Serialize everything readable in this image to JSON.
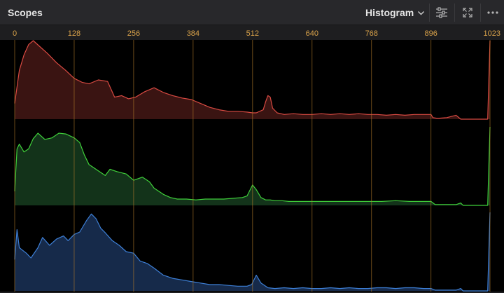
{
  "panel": {
    "title": "Scopes",
    "mode_label": "Histogram",
    "icons": [
      "chevron-down-icon",
      "sliders-icon",
      "expand-icon",
      "more-icon"
    ]
  },
  "colors": {
    "header_bg": "#28282b",
    "plot_bg": "#000000",
    "guide": "#b07a2a",
    "tick_text": "#d9a24a",
    "red_line": "#d94a42",
    "red_fill": "#3a1412",
    "green_line": "#3fcf3a",
    "green_fill": "#13331a",
    "blue_line": "#3d7fd6",
    "blue_fill": "#162a4a"
  },
  "chart_data": {
    "type": "area",
    "x_ticks": [
      "0",
      "128",
      "256",
      "384",
      "512",
      "640",
      "768",
      "896",
      "1023"
    ],
    "xlim": [
      0,
      1023
    ],
    "ylim": [
      0,
      1
    ],
    "grid": true,
    "series": [
      {
        "channel": "red",
        "x": [
          0,
          10,
          20,
          30,
          40,
          55,
          70,
          90,
          110,
          128,
          145,
          160,
          180,
          200,
          215,
          230,
          245,
          260,
          280,
          300,
          320,
          340,
          360,
          380,
          400,
          420,
          440,
          460,
          480,
          500,
          512,
          520,
          535,
          540,
          545,
          550,
          555,
          565,
          580,
          600,
          620,
          640,
          660,
          680,
          700,
          720,
          740,
          760,
          780,
          800,
          820,
          840,
          860,
          880,
          896,
          900,
          910,
          930,
          950,
          960,
          965,
          970,
          990,
          1010,
          1018,
          1023
        ],
        "y": [
          0.2,
          0.62,
          0.82,
          0.95,
          1.0,
          0.92,
          0.84,
          0.72,
          0.62,
          0.52,
          0.47,
          0.45,
          0.5,
          0.48,
          0.28,
          0.3,
          0.26,
          0.28,
          0.35,
          0.4,
          0.34,
          0.3,
          0.27,
          0.25,
          0.2,
          0.15,
          0.12,
          0.1,
          0.1,
          0.09,
          0.08,
          0.08,
          0.12,
          0.22,
          0.3,
          0.28,
          0.14,
          0.08,
          0.06,
          0.07,
          0.06,
          0.06,
          0.07,
          0.06,
          0.07,
          0.06,
          0.07,
          0.06,
          0.06,
          0.05,
          0.06,
          0.05,
          0.06,
          0.06,
          0.06,
          0.02,
          0.01,
          0.02,
          0.05,
          0.0,
          0.0,
          0.0,
          0.0,
          0.0,
          0.0,
          1.0
        ]
      },
      {
        "channel": "green",
        "x": [
          0,
          5,
          10,
          20,
          30,
          40,
          50,
          65,
          80,
          95,
          110,
          128,
          140,
          150,
          160,
          180,
          195,
          205,
          220,
          240,
          256,
          275,
          290,
          300,
          320,
          335,
          350,
          370,
          390,
          410,
          430,
          450,
          470,
          490,
          500,
          512,
          520,
          530,
          540,
          550,
          560,
          575,
          590,
          610,
          640,
          670,
          700,
          730,
          760,
          790,
          820,
          850,
          880,
          896,
          905,
          920,
          950,
          960,
          965,
          975,
          990,
          1010,
          1018,
          1023
        ],
        "y": [
          0.18,
          0.72,
          0.78,
          0.68,
          0.72,
          0.85,
          0.92,
          0.84,
          0.86,
          0.92,
          0.91,
          0.86,
          0.8,
          0.64,
          0.52,
          0.44,
          0.38,
          0.46,
          0.43,
          0.4,
          0.32,
          0.36,
          0.3,
          0.22,
          0.14,
          0.1,
          0.08,
          0.08,
          0.07,
          0.08,
          0.08,
          0.08,
          0.09,
          0.1,
          0.12,
          0.26,
          0.2,
          0.1,
          0.07,
          0.07,
          0.06,
          0.06,
          0.05,
          0.05,
          0.05,
          0.05,
          0.05,
          0.05,
          0.05,
          0.05,
          0.06,
          0.05,
          0.05,
          0.05,
          0.01,
          0.01,
          0.01,
          0.03,
          0.0,
          0.0,
          0.0,
          0.0,
          0.0,
          1.0
        ]
      },
      {
        "channel": "blue",
        "x": [
          0,
          5,
          10,
          25,
          35,
          50,
          60,
          75,
          90,
          105,
          115,
          128,
          140,
          155,
          165,
          175,
          185,
          195,
          210,
          225,
          240,
          256,
          270,
          285,
          300,
          320,
          340,
          360,
          380,
          400,
          420,
          440,
          460,
          480,
          500,
          510,
          520,
          530,
          545,
          560,
          580,
          600,
          620,
          640,
          660,
          680,
          700,
          720,
          740,
          760,
          780,
          800,
          820,
          840,
          860,
          880,
          896,
          905,
          920,
          950,
          960,
          965,
          975,
          990,
          1010,
          1018,
          1023
        ],
        "y": [
          0.4,
          0.78,
          0.55,
          0.48,
          0.42,
          0.55,
          0.68,
          0.58,
          0.66,
          0.7,
          0.64,
          0.72,
          0.75,
          0.9,
          0.98,
          0.92,
          0.8,
          0.74,
          0.64,
          0.58,
          0.5,
          0.48,
          0.38,
          0.35,
          0.29,
          0.2,
          0.16,
          0.14,
          0.12,
          0.1,
          0.08,
          0.08,
          0.07,
          0.06,
          0.06,
          0.08,
          0.2,
          0.1,
          0.04,
          0.03,
          0.04,
          0.03,
          0.04,
          0.03,
          0.03,
          0.04,
          0.03,
          0.04,
          0.03,
          0.03,
          0.04,
          0.04,
          0.03,
          0.04,
          0.04,
          0.03,
          0.03,
          0.01,
          0.01,
          0.01,
          0.03,
          0.0,
          0.0,
          0.0,
          0.0,
          0.0,
          1.0
        ]
      }
    ]
  }
}
